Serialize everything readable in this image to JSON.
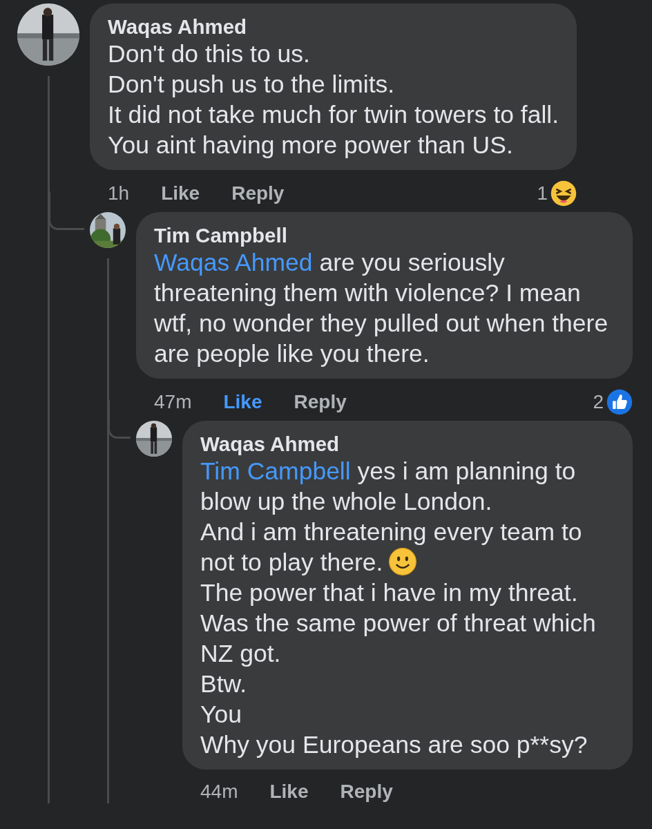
{
  "comments": [
    {
      "author": "Waqas Ahmed",
      "paragraphs": [
        {
          "text": "Don't do this to us."
        },
        {
          "text": "Don't push us to the limits."
        },
        {
          "text": "It did not take much for twin towers to fall."
        },
        {
          "text": "You aint having more power than US."
        }
      ],
      "time": "1h",
      "like_label": "Like",
      "liked": false,
      "reply_label": "Reply",
      "reaction": {
        "count": "1",
        "kind": "haha"
      },
      "children": [
        {
          "author": "Tim Campbell",
          "mention": "Waqas Ahmed",
          "paragraphs": [
            {
              "text": "are you seriously threatening them with violence? I mean wtf, no wonder they pulled out when there are people like you there."
            }
          ],
          "time": "47m",
          "like_label": "Like",
          "liked": true,
          "reply_label": "Reply",
          "reaction": {
            "count": "2",
            "kind": "like"
          },
          "children": [
            {
              "author": "Waqas Ahmed",
              "mention": "Tim Campbell",
              "paragraphs": [
                {
                  "text": "yes i am planning to blow up the whole London."
                },
                {
                  "text": "And i am threatening every team to not to play there.",
                  "trailing_emoji": true
                },
                {
                  "text": "The power that i have in my threat."
                },
                {
                  "text": "Was the same power of threat which NZ got."
                },
                {
                  "text": "Btw."
                },
                {
                  "text": "You"
                },
                {
                  "text": "Why you Europeans are soo p**sy?"
                }
              ],
              "time": "44m",
              "like_label": "Like",
              "liked": false,
              "reply_label": "Reply"
            }
          ]
        }
      ]
    }
  ]
}
